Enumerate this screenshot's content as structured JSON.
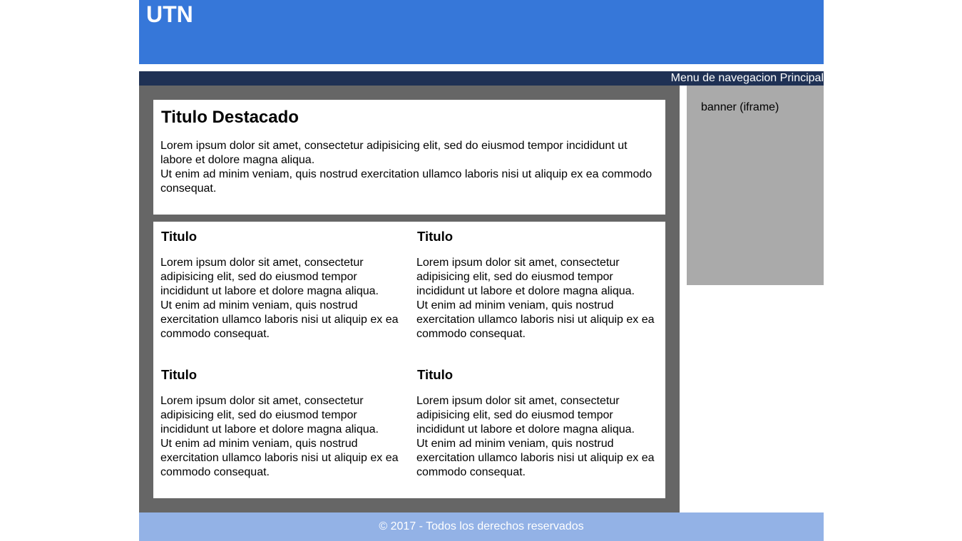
{
  "header": {
    "title": "UTN"
  },
  "nav": {
    "label": "Menu de navegacion Principal"
  },
  "featured": {
    "title": "Titulo Destacado",
    "paragraph1": "Lorem ipsum dolor sit amet, consectetur adipisicing elit, sed do eiusmod tempor incididunt ut labore et dolore magna aliqua.",
    "paragraph2": "Ut enim ad minim veniam, quis nostrud exercitation ullamco laboris nisi ut aliquip ex ea commodo consequat."
  },
  "articles": [
    {
      "title": "Titulo",
      "paragraph1": "Lorem ipsum dolor sit amet, consectetur adipisicing elit, sed do eiusmod tempor incididunt ut labore et dolore magna aliqua.",
      "paragraph2": "Ut enim ad minim veniam, quis nostrud exercitation ullamco laboris nisi ut aliquip ex ea commodo consequat."
    },
    {
      "title": "Titulo",
      "paragraph1": "Lorem ipsum dolor sit amet, consectetur adipisicing elit, sed do eiusmod tempor incididunt ut labore et dolore magna aliqua.",
      "paragraph2": "Ut enim ad minim veniam, quis nostrud exercitation ullamco laboris nisi ut aliquip ex ea commodo consequat."
    },
    {
      "title": "Titulo",
      "paragraph1": "Lorem ipsum dolor sit amet, consectetur adipisicing elit, sed do eiusmod tempor incididunt ut labore et dolore magna aliqua.",
      "paragraph2": "Ut enim ad minim veniam, quis nostrud exercitation ullamco laboris nisi ut aliquip ex ea commodo consequat."
    },
    {
      "title": "Titulo",
      "paragraph1": "Lorem ipsum dolor sit amet, consectetur adipisicing elit, sed do eiusmod tempor incididunt ut labore et dolore magna aliqua.",
      "paragraph2": "Ut enim ad minim veniam, quis nostrud exercitation ullamco laboris nisi ut aliquip ex ea commodo consequat."
    }
  ],
  "aside": {
    "label": "banner (iframe)"
  },
  "footer": {
    "text": "© 2017 - Todos los derechos reservados"
  },
  "colors": {
    "header_bg": "#3677d9",
    "nav_bg": "#1f3154",
    "main_bg": "#666666",
    "aside_bg": "#aaaaaa",
    "footer_bg": "#93b2e6"
  }
}
